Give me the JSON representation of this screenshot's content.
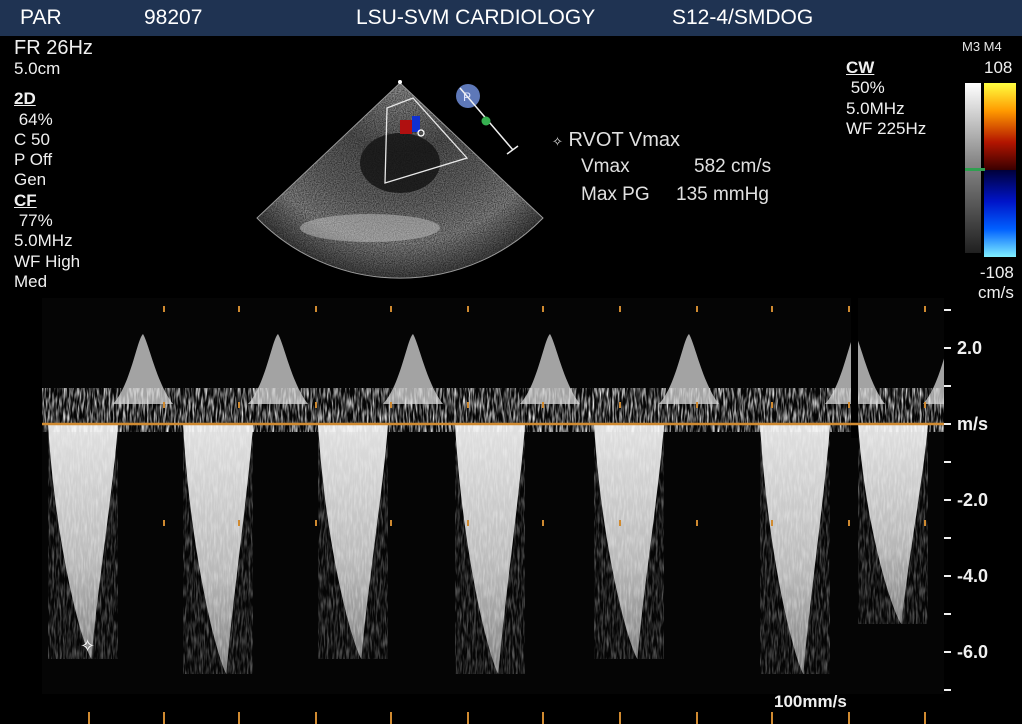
{
  "header": {
    "mode": "PAR",
    "patient_id": "98207",
    "institution": "LSU-SVM CARDIOLOGY",
    "probe": "S12-4/SMDOG"
  },
  "left_panel": {
    "frame_rate": "FR 26Hz",
    "depth": "5.0cm",
    "twod_title": "2D",
    "twod_gain": " 64%",
    "compression": "C 50",
    "persistence": "P Off",
    "frequency_mode": "Gen",
    "cf_title": "CF",
    "cf_gain": " 77%",
    "cf_frequency": "5.0MHz",
    "wall_filter": "WF High",
    "cf_mode": "Med"
  },
  "right_panel": {
    "cw_title": "CW",
    "cw_gain": " 50%",
    "cw_frequency": "5.0MHz",
    "wall_filter": "WF 225Hz"
  },
  "color_bar": {
    "map_label": "M3 M4",
    "top_value": "108",
    "bottom_value": "-108",
    "unit": "cm/s"
  },
  "measurement": {
    "title": "RVOT Vmax",
    "rows": [
      {
        "label": "Vmax",
        "value": "582 cm/s"
      },
      {
        "label": "Max PG",
        "value": "135 mmHg"
      }
    ]
  },
  "doppler": {
    "unit": "m/s",
    "axis_labels": [
      "2.0",
      "-2.0",
      "-4.0",
      "-6.0"
    ],
    "sweep_speed": "100mm/s",
    "baseline_color": "#d08a30"
  },
  "colors": {
    "header_bg": "#1f3352",
    "marker_green": "#2fa050"
  }
}
